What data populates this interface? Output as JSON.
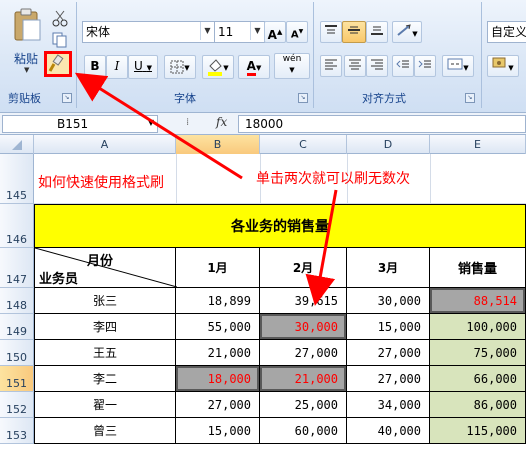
{
  "ribbon": {
    "clipboard": {
      "paste_label": "粘贴",
      "group_label": "剪贴板"
    },
    "font": {
      "name": "宋体",
      "size": "11",
      "grow": "A",
      "shrink": "A",
      "bold": "B",
      "italic": "I",
      "underline": "U",
      "font_color_glyph": "A",
      "phonetic_glyph": "wén",
      "group_label": "字体"
    },
    "alignment": {
      "group_label": "对齐方式"
    },
    "number": {
      "format": "自定义"
    }
  },
  "formula_bar": {
    "name_box": "B151",
    "fx": "fx",
    "value": "18000"
  },
  "columns": [
    "A",
    "B",
    "C",
    "D",
    "E"
  ],
  "rows": [
    "145",
    "146",
    "147",
    "148",
    "149",
    "150",
    "151",
    "152",
    "153"
  ],
  "annotations": {
    "left_note": "如何快速使用格式刷",
    "right_note": "单击两次就可以刷无数次"
  },
  "table": {
    "title": "各业务的销售量",
    "corner_top": "月份",
    "corner_bottom": "业务员",
    "headers": [
      "1月",
      "2月",
      "3月",
      "销售量"
    ],
    "rows": [
      {
        "name": "张三",
        "m1": "18,899",
        "m2": "39,615",
        "m3": "30,000",
        "total": "88,514"
      },
      {
        "name": "李四",
        "m1": "55,000",
        "m2": "30,000",
        "m3": "15,000",
        "total": "100,000"
      },
      {
        "name": "王五",
        "m1": "21,000",
        "m2": "27,000",
        "m3": "27,000",
        "total": "75,000"
      },
      {
        "name": "李二",
        "m1": "18,000",
        "m2": "21,000",
        "m3": "27,000",
        "total": "66,000"
      },
      {
        "name": "翟一",
        "m1": "27,000",
        "m2": "25,000",
        "m3": "34,000",
        "total": "86,000"
      },
      {
        "name": "曾三",
        "m1": "15,000",
        "m2": "60,000",
        "m3": "40,000",
        "total": "115,000"
      }
    ]
  },
  "colors": {
    "title_fill": "#ffff00",
    "total_fill": "#d8e4bc",
    "highlight_fill": "#a6a6a6",
    "highlight_text": "#ff0000",
    "annotation_red": "#ff0000",
    "selected_header": "#f9c97d"
  }
}
